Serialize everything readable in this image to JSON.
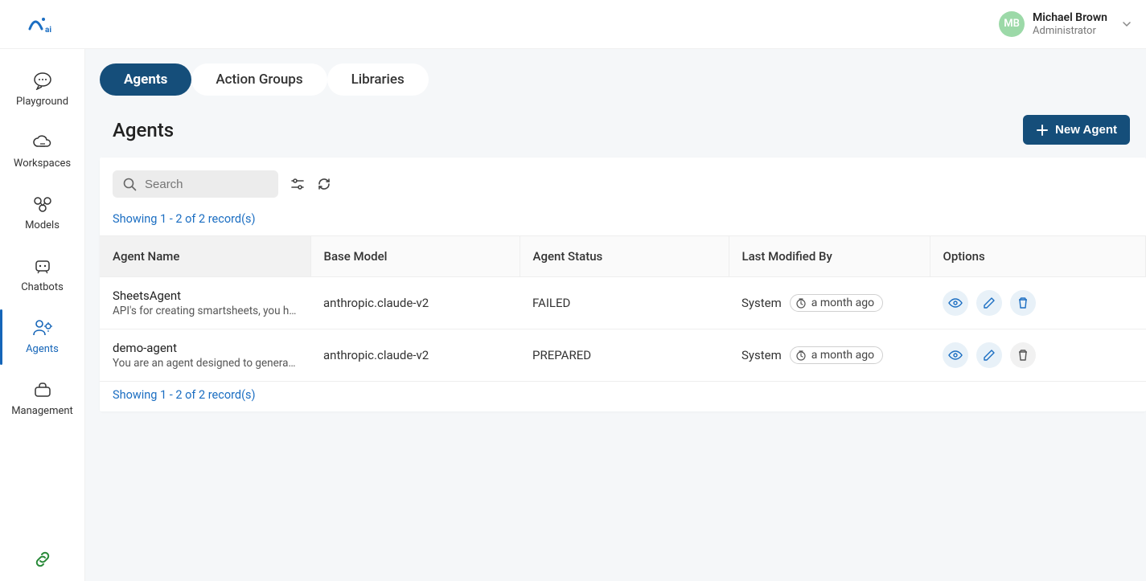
{
  "header": {
    "user": {
      "initials": "MB",
      "name": "Michael Brown",
      "role": "Administrator"
    }
  },
  "sidebar": {
    "items": [
      {
        "id": "playground",
        "label": "Playground"
      },
      {
        "id": "workspaces",
        "label": "Workspaces"
      },
      {
        "id": "models",
        "label": "Models"
      },
      {
        "id": "chatbots",
        "label": "Chatbots"
      },
      {
        "id": "agents",
        "label": "Agents"
      },
      {
        "id": "management",
        "label": "Management"
      }
    ]
  },
  "tabs": [
    {
      "id": "agents",
      "label": "Agents",
      "active": true
    },
    {
      "id": "action-groups",
      "label": "Action Groups",
      "active": false
    },
    {
      "id": "libraries",
      "label": "Libraries",
      "active": false
    }
  ],
  "page": {
    "title": "Agents",
    "newButton": "New Agent",
    "search": {
      "placeholder": "Search"
    },
    "recordsText": "Showing 1 - 2 of 2 record(s)"
  },
  "table": {
    "columns": {
      "agentName": "Agent Name",
      "baseModel": "Base Model",
      "agentStatus": "Agent Status",
      "lastModifiedBy": "Last Modified By",
      "options": "Options"
    },
    "rows": [
      {
        "name": "SheetsAgent",
        "desc": "API's for creating smartsheets, you ha…",
        "baseModel": "anthropic.claude-v2",
        "status": "FAILED",
        "modifiedBy": "System",
        "modifiedAt": "a month ago"
      },
      {
        "name": "demo-agent",
        "desc": "You are an agent designed to generate…",
        "baseModel": "anthropic.claude-v2",
        "status": "PREPARED",
        "modifiedBy": "System",
        "modifiedAt": "a month ago"
      }
    ]
  }
}
